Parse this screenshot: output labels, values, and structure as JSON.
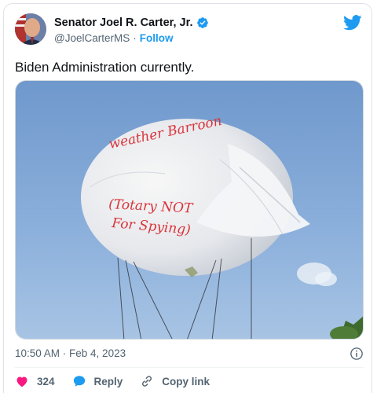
{
  "author": {
    "display_name": "Senator Joel R. Carter, Jr.",
    "handle": "@JoelCarterMS",
    "separator": "·",
    "follow_label": "Follow",
    "verified": true
  },
  "tweet": {
    "text": "Biden Administration currently."
  },
  "media": {
    "balloon_text_line1": "weather Barroon",
    "balloon_text_line2": "(Totary NOT",
    "balloon_text_line3": "For Spying)"
  },
  "meta": {
    "timestamp": "10:50 AM · Feb 4, 2023"
  },
  "actions": {
    "like_count": "324",
    "reply_label": "Reply",
    "copy_link_label": "Copy link"
  },
  "colors": {
    "accent": "#1d9bf0",
    "like": "#f91880",
    "text_secondary": "#536471"
  },
  "icons": [
    "verified-icon",
    "twitter-logo-icon",
    "info-icon",
    "heart-icon",
    "reply-icon",
    "link-icon"
  ]
}
